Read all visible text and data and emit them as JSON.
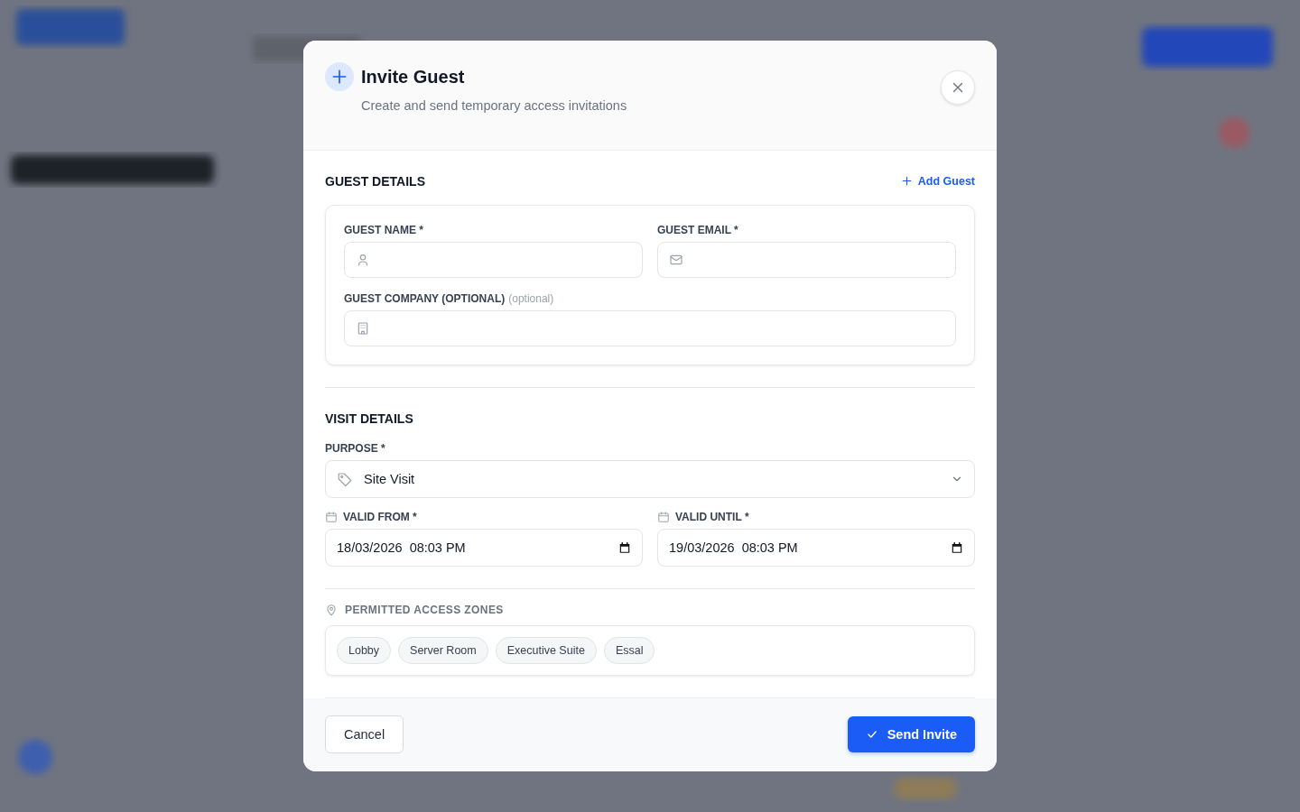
{
  "dialog": {
    "title": "Invite Guest",
    "subtitle": "Create and send temporary access invitations"
  },
  "guest_details": {
    "heading": "GUEST DETAILS",
    "add_link": "Add Guest",
    "fields": [
      {
        "label": "GUEST NAME *"
      },
      {
        "label": "GUEST EMAIL *"
      },
      {
        "label": "GUEST COMPANY (OPTIONAL)",
        "hint": "(optional)"
      }
    ]
  },
  "visit_details": {
    "heading": "VISIT DETAILS",
    "purpose": {
      "label": "PURPOSE *",
      "value": "Site Visit"
    },
    "valid_from": {
      "label": "VALID FROM *",
      "value": "18/03/2026  08:03 PM"
    },
    "valid_until": {
      "label": "VALID UNTIL *",
      "value": "19/03/2026  08:03 PM"
    }
  },
  "access_zones": {
    "heading": "PERMITTED ACCESS ZONES",
    "zones": [
      {
        "label": "Lobby",
        "selected": false
      },
      {
        "label": "Server Room",
        "selected": false
      },
      {
        "label": "Executive Suite",
        "selected": false
      },
      {
        "label": "Essal",
        "selected": false
      }
    ]
  },
  "buttons": {
    "cancel": "Cancel",
    "submit": "Send Invite"
  }
}
